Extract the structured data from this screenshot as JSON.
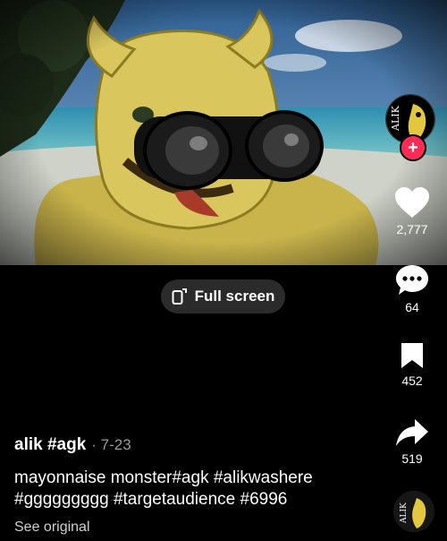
{
  "video": {
    "description_icon": "yellow-horned-creature-with-binoculars",
    "colors": {
      "sky": "#4c84b8",
      "sea": "#3fa0b5",
      "sand": "#d8dad2",
      "creature": "#d7c45a"
    }
  },
  "controls": {
    "fullscreen_label": "Full screen",
    "fullscreen_icon": "fullscreen-icon"
  },
  "profile": {
    "avatar_text": "ALIK",
    "follow_icon": "plus-icon",
    "badge_color": "#fe2c55"
  },
  "actions": {
    "likes": "2,777",
    "comments": "64",
    "bookmarks": "452",
    "shares": "519"
  },
  "caption": {
    "author": "alik #agk",
    "date": "· 7-23",
    "description": "mayonnaise monster#agk #alikwashere #ggggggggg #targetaudience #6996",
    "see_original": "See original"
  },
  "music": {
    "disc_text": "ALIK"
  }
}
